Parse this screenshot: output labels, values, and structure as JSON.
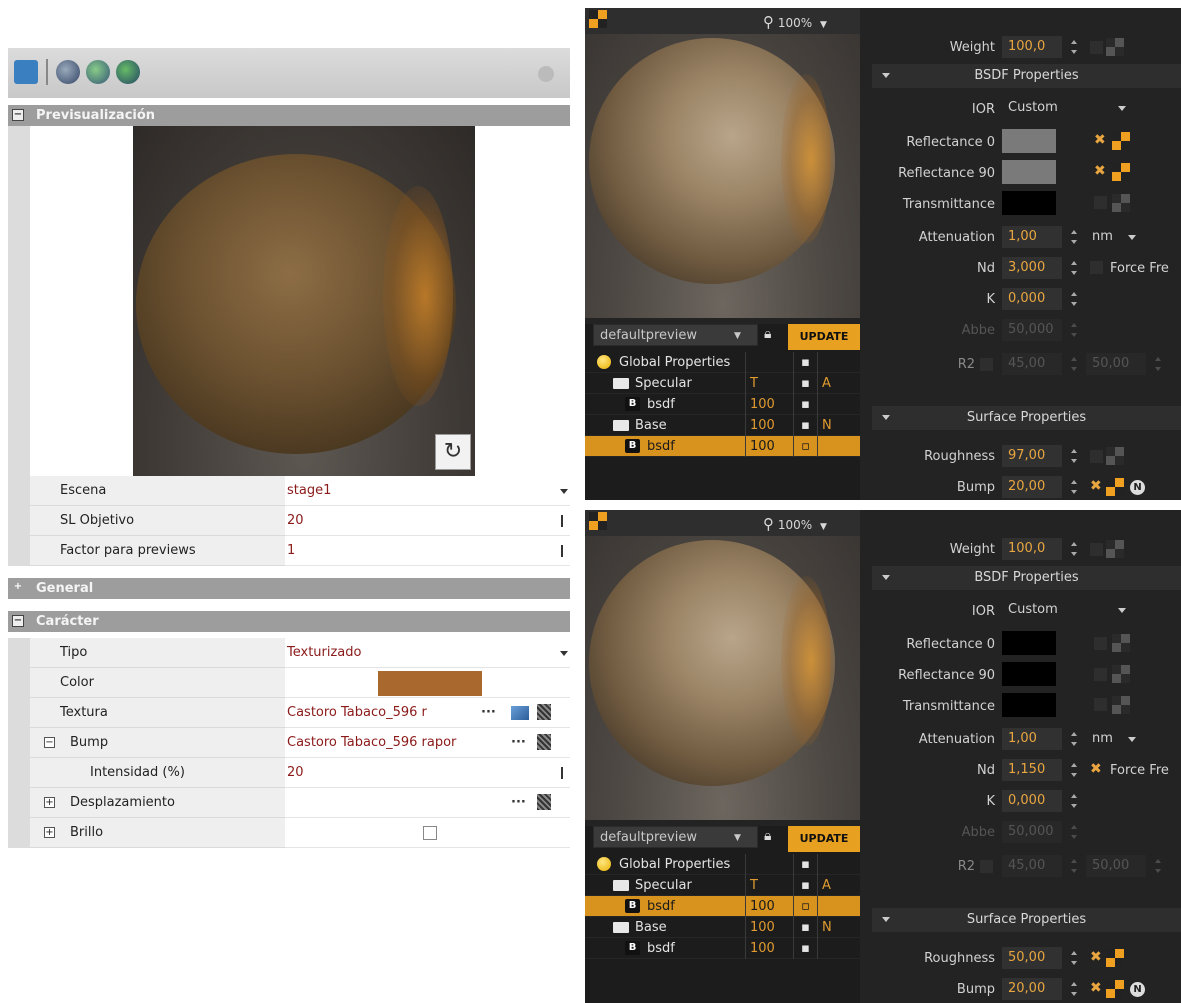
{
  "left": {
    "section_preview": "Previsualización",
    "scene_label": "Escena",
    "scene_value": "stage1",
    "sl_label": "SL Objetivo",
    "sl_value": "20",
    "factor_label": "Factor para previews",
    "factor_value": "1",
    "section_general": "General",
    "section_character": "Carácter",
    "tipo_label": "Tipo",
    "tipo_value": "Texturizado",
    "color_label": "Color",
    "color_value": "#a8682e",
    "textura_label": "Textura",
    "textura_value": "Castoro Tabaco_596 r",
    "bump_label": "Bump",
    "bump_value": "Castoro Tabaco_596 rapor",
    "intensidad_label": "Intensidad (%)",
    "intensidad_value": "20",
    "desplazamiento_label": "Desplazamiento",
    "brillo_label": "Brillo",
    "dots": "···"
  },
  "panels": [
    {
      "zoom": "100%",
      "preview_select": "defaultpreview",
      "update": "UPDATE",
      "tree": [
        {
          "name": "Global Properties",
          "c1": "",
          "c2": "▪",
          "c3": ""
        },
        {
          "name": "Specular",
          "c1": "T",
          "c2": "▪",
          "c3": "A"
        },
        {
          "name": "bsdf",
          "c1": "100",
          "c2": "▪",
          "c3": ""
        },
        {
          "name": "Base",
          "c1": "100",
          "c2": "▪",
          "c3": "N"
        },
        {
          "name": "bsdf",
          "c1": "100",
          "c2": "▫",
          "c3": ""
        }
      ],
      "weight_label": "Weight",
      "weight": "100,0",
      "bsdf_title": "BSDF Properties",
      "ior_label": "IOR",
      "ior": "Custom",
      "refl0_label": "Reflectance 0",
      "refl0_color": "#7a7a7a",
      "refl90_label": "Reflectance 90",
      "refl90_color": "#7a7a7a",
      "trans_label": "Transmittance",
      "trans_color": "#000000",
      "att_label": "Attenuation",
      "att": "1,00",
      "att_unit": "nm",
      "nd_label": "Nd",
      "nd": "3,000",
      "force": "Force Fre",
      "k_label": "K",
      "k": "0,000",
      "abbe_label": "Abbe",
      "abbe": "50,000",
      "r2_label": "R2",
      "r2a": "45,00",
      "r2b": "50,00",
      "surface_title": "Surface Properties",
      "rough_label": "Roughness",
      "rough": "97,00",
      "bump_label": "Bump",
      "bump": "20,00"
    },
    {
      "zoom": "100%",
      "preview_select": "defaultpreview",
      "update": "UPDATE",
      "tree": [
        {
          "name": "Global Properties",
          "c1": "",
          "c2": "▪",
          "c3": ""
        },
        {
          "name": "Specular",
          "c1": "T",
          "c2": "▪",
          "c3": "A"
        },
        {
          "name": "bsdf",
          "c1": "100",
          "c2": "▫",
          "c3": ""
        },
        {
          "name": "Base",
          "c1": "100",
          "c2": "▪",
          "c3": "N"
        },
        {
          "name": "bsdf",
          "c1": "100",
          "c2": "▪",
          "c3": ""
        }
      ],
      "weight_label": "Weight",
      "weight": "100,0",
      "bsdf_title": "BSDF Properties",
      "ior_label": "IOR",
      "ior": "Custom",
      "refl0_label": "Reflectance 0",
      "refl0_color": "#000000",
      "refl90_label": "Reflectance 90",
      "refl90_color": "#000000",
      "trans_label": "Transmittance",
      "trans_color": "#000000",
      "att_label": "Attenuation",
      "att": "1,00",
      "att_unit": "nm",
      "nd_label": "Nd",
      "nd": "1,150",
      "force": "Force Fre",
      "k_label": "K",
      "k": "0,000",
      "abbe_label": "Abbe",
      "abbe": "50,000",
      "r2_label": "R2",
      "r2a": "45,00",
      "r2b": "50,00",
      "surface_title": "Surface Properties",
      "rough_label": "Roughness",
      "rough": "50,00",
      "bump_label": "Bump",
      "bump": "20,00"
    }
  ]
}
